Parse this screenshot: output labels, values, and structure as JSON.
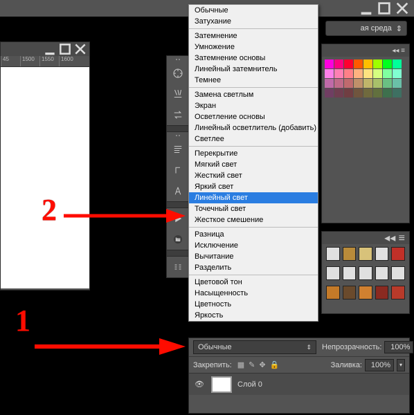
{
  "workspace_label": "ая среда",
  "ruler_marks": [
    "45",
    "1500",
    "1550",
    "1600"
  ],
  "blend_modes": {
    "group1": [
      "Обычные",
      "Затухание"
    ],
    "group2": [
      "Затемнение",
      "Умножение",
      "Затемнение основы",
      "Линейный затемнитель",
      "Темнее"
    ],
    "group3": [
      "Замена светлым",
      "Экран",
      "Осветление основы",
      "Линейный осветлитель (добавить)",
      "Светлее"
    ],
    "group4": [
      "Перекрытие",
      "Мягкий свет",
      "Жесткий свет",
      "Яркий свет",
      "Линейный свет",
      "Точечный свет",
      "Жесткое смешение"
    ],
    "group5": [
      "Разница",
      "Исключение",
      "Вычитание",
      "Разделить"
    ],
    "group6": [
      "Цветовой тон",
      "Насыщенность",
      "Цветность",
      "Яркость"
    ],
    "selected": "Линейный свет"
  },
  "layers_panel": {
    "blend_dropdown": "Обычные",
    "opacity_label": "Непрозрачность:",
    "opacity_value": "100%",
    "lock_label": "Закрепить:",
    "fill_label": "Заливка:",
    "fill_value": "100%",
    "layer_name": "Слой 0"
  },
  "swatches_colors": [
    "#ff00de",
    "#ff0080",
    "#ff0030",
    "#ff5a00",
    "#ffbf00",
    "#9fff00",
    "#00ff1e",
    "#00ff9a",
    "#ff80ea",
    "#ff80b4",
    "#ff8088",
    "#ffb380",
    "#ffe380",
    "#d5ff80",
    "#80ffa0",
    "#80ffd1",
    "#c06aa9",
    "#c06a89",
    "#c06a6e",
    "#c0906a",
    "#c0b56a",
    "#a8c06a",
    "#6ac083",
    "#6ac0a8",
    "#703e62",
    "#703e50",
    "#703e42",
    "#70553e",
    "#706a3e",
    "#62703e",
    "#3e704d",
    "#3e7062"
  ],
  "styles_swatches": {
    "row1": [
      "#e0e0e0",
      "#b98b3a",
      "#d8c27a",
      "#e0e0e0",
      "#c03028"
    ],
    "row2": [
      "#e0e0e0",
      "#e0e0e0",
      "#e0e0e0",
      "#e0e0e0",
      "#e0e0e0"
    ],
    "row3": [
      "#c47a28",
      "#6a4a2c",
      "#d08030",
      "#8a2a20",
      "#b83a2a"
    ]
  },
  "annotations": {
    "one": "1",
    "two": "2"
  }
}
